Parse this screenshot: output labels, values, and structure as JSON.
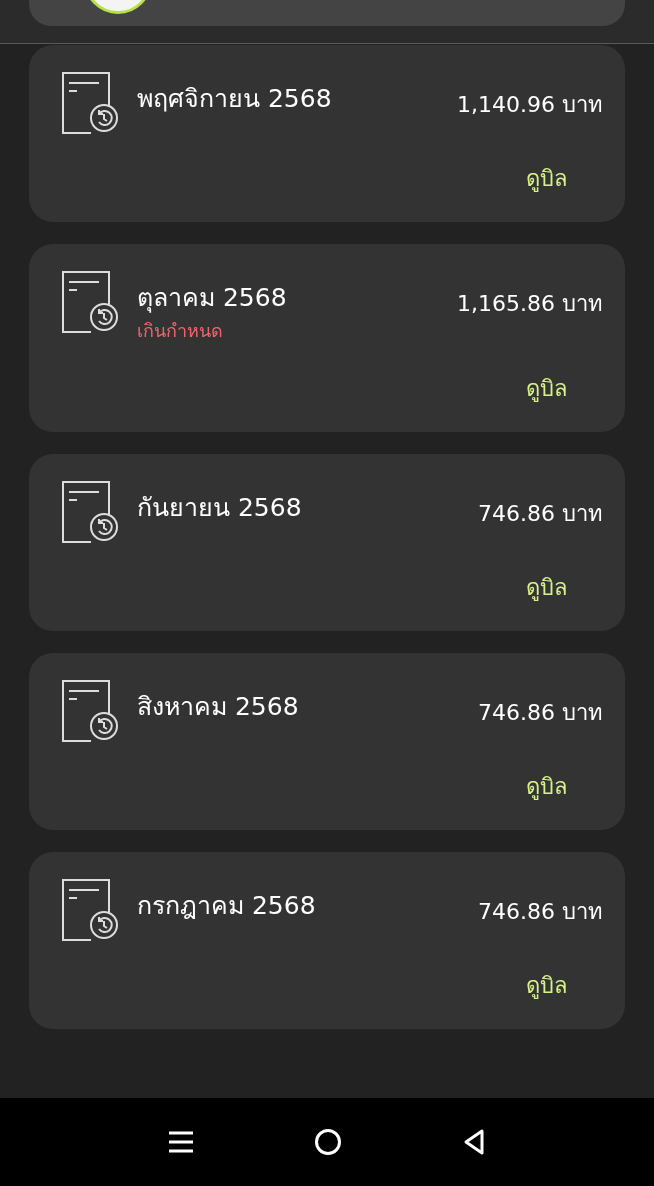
{
  "bills": [
    {
      "month": "พฤศจิกายน 2568",
      "amount": "1,140.96 บาท",
      "action": "ดูบิล"
    },
    {
      "month": "ตุลาคม 2568",
      "amount": "1,165.86 บาท",
      "status": "เกินกำหนด",
      "action": "ดูบิล"
    },
    {
      "month": "กันยายน 2568",
      "amount": "746.86 บาท",
      "action": "ดูบิล"
    },
    {
      "month": "สิงหาคม 2568",
      "amount": "746.86 บาท",
      "action": "ดูบิล"
    },
    {
      "month": "กรกฎาคม 2568",
      "amount": "746.86 บาท",
      "action": "ดูบิล"
    }
  ]
}
